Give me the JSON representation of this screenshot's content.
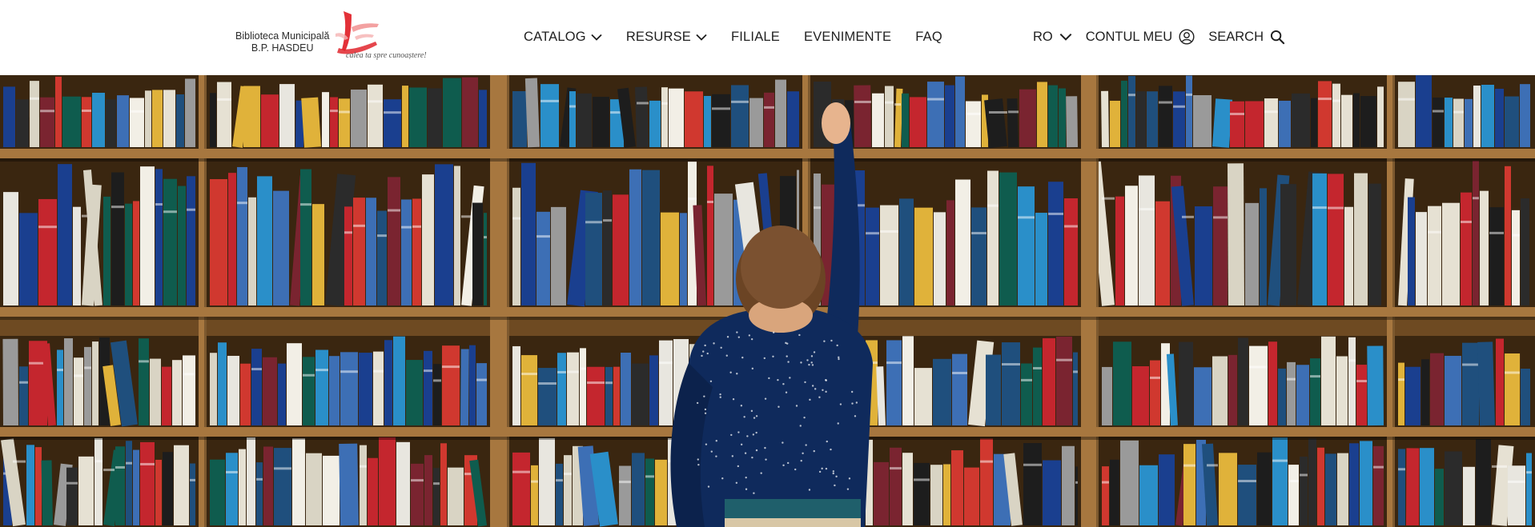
{
  "logo": {
    "line1": "Biblioteca Municipală",
    "line2": "B.P. HASDEU",
    "tagline": "calea ta spre cunoaștere!",
    "accent": "#e1262d"
  },
  "nav": {
    "items": [
      {
        "label": "CATALOG",
        "dropdown": true
      },
      {
        "label": "RESURSE",
        "dropdown": true
      },
      {
        "label": "FILIALE",
        "dropdown": false
      },
      {
        "label": "EVENIMENTE",
        "dropdown": false
      },
      {
        "label": "FAQ",
        "dropdown": false
      }
    ]
  },
  "utility": {
    "language": "RO",
    "account": "CONTUL MEU",
    "search": "SEARCH",
    "account_icon": "user-circle-icon",
    "search_icon": "search-icon"
  },
  "hero": {
    "image": "boy-reaching-for-book-on-library-shelves",
    "shelf_color": "#a7773f",
    "shirt_color": "#0f2a5c"
  }
}
